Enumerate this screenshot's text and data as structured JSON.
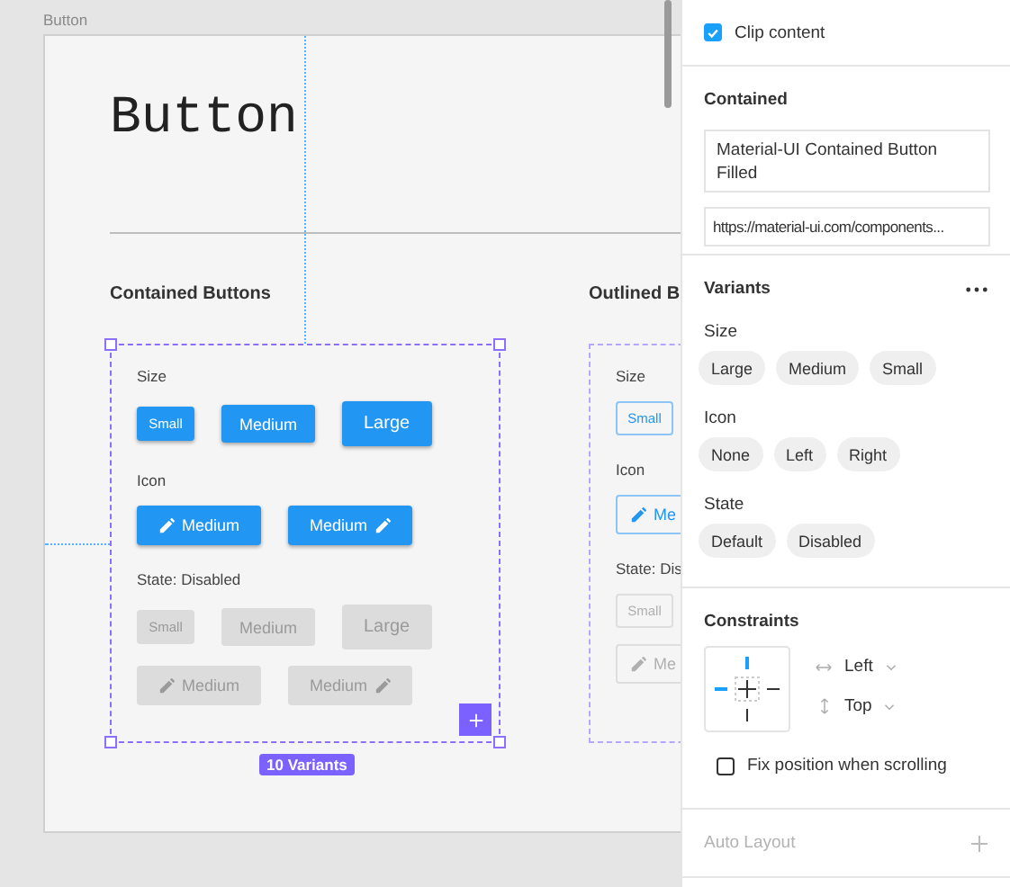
{
  "canvas": {
    "frame_label": "Button",
    "frame_title": "Button",
    "sets": [
      {
        "heading": "Contained Buttons",
        "kind": "contained",
        "selected": true,
        "badge": "10 Variants",
        "groups": [
          {
            "label": "Size",
            "rows": [
              [
                {
                  "text": "Small",
                  "kind": "small",
                  "disabled": false
                },
                {
                  "text": "Medium",
                  "kind": "medium",
                  "disabled": false
                },
                {
                  "text": "Large",
                  "kind": "large",
                  "disabled": false
                }
              ]
            ]
          },
          {
            "label": "Icon",
            "rows": [
              [
                {
                  "text": "Medium",
                  "kind": "icon-left",
                  "disabled": false
                },
                {
                  "text": "Medium",
                  "kind": "icon-right",
                  "disabled": false
                }
              ]
            ]
          },
          {
            "label": "State: Disabled",
            "rows": [
              [
                {
                  "text": "Small",
                  "kind": "small",
                  "disabled": true
                },
                {
                  "text": "Medium",
                  "kind": "medium",
                  "disabled": true
                },
                {
                  "text": "Large",
                  "kind": "large",
                  "disabled": true
                }
              ],
              [
                {
                  "text": "Medium",
                  "kind": "icon-left",
                  "disabled": true
                },
                {
                  "text": "Medium",
                  "kind": "icon-right",
                  "disabled": true
                }
              ]
            ]
          }
        ]
      },
      {
        "heading": "Outlined B",
        "kind": "outlined",
        "selected": false,
        "groups": [
          {
            "label": "Size",
            "rows": [
              [
                {
                  "text": "Small",
                  "kind": "small",
                  "disabled": false
                }
              ]
            ]
          },
          {
            "label": "Icon",
            "rows": [
              [
                {
                  "text": "Me",
                  "kind": "icon-left",
                  "disabled": false
                }
              ]
            ]
          },
          {
            "label": "State: Dis",
            "rows": [
              [
                {
                  "text": "Small",
                  "kind": "small",
                  "disabled": true
                }
              ],
              [
                {
                  "text": "Me",
                  "kind": "icon-left",
                  "disabled": true
                }
              ]
            ]
          }
        ]
      }
    ]
  },
  "panel": {
    "clip_content": {
      "label": "Clip content",
      "checked": true
    },
    "component": {
      "title": "Contained",
      "description": "Material-UI Contained Button Filled",
      "link": "https://material-ui.com/components..."
    },
    "variants": {
      "title": "Variants",
      "properties": [
        {
          "name": "Size",
          "values": [
            "Large",
            "Medium",
            "Small"
          ]
        },
        {
          "name": "Icon",
          "values": [
            "None",
            "Left",
            "Right"
          ]
        },
        {
          "name": "State",
          "values": [
            "Default",
            "Disabled"
          ]
        }
      ]
    },
    "constraints": {
      "title": "Constraints",
      "pins": {
        "left": true,
        "right": false,
        "top": true,
        "bottom": false
      },
      "horizontal": "Left",
      "vertical": "Top",
      "fix_position": {
        "label": "Fix position when scrolling",
        "checked": false
      }
    },
    "auto_layout": {
      "title": "Auto Layout",
      "enabled": false
    }
  }
}
